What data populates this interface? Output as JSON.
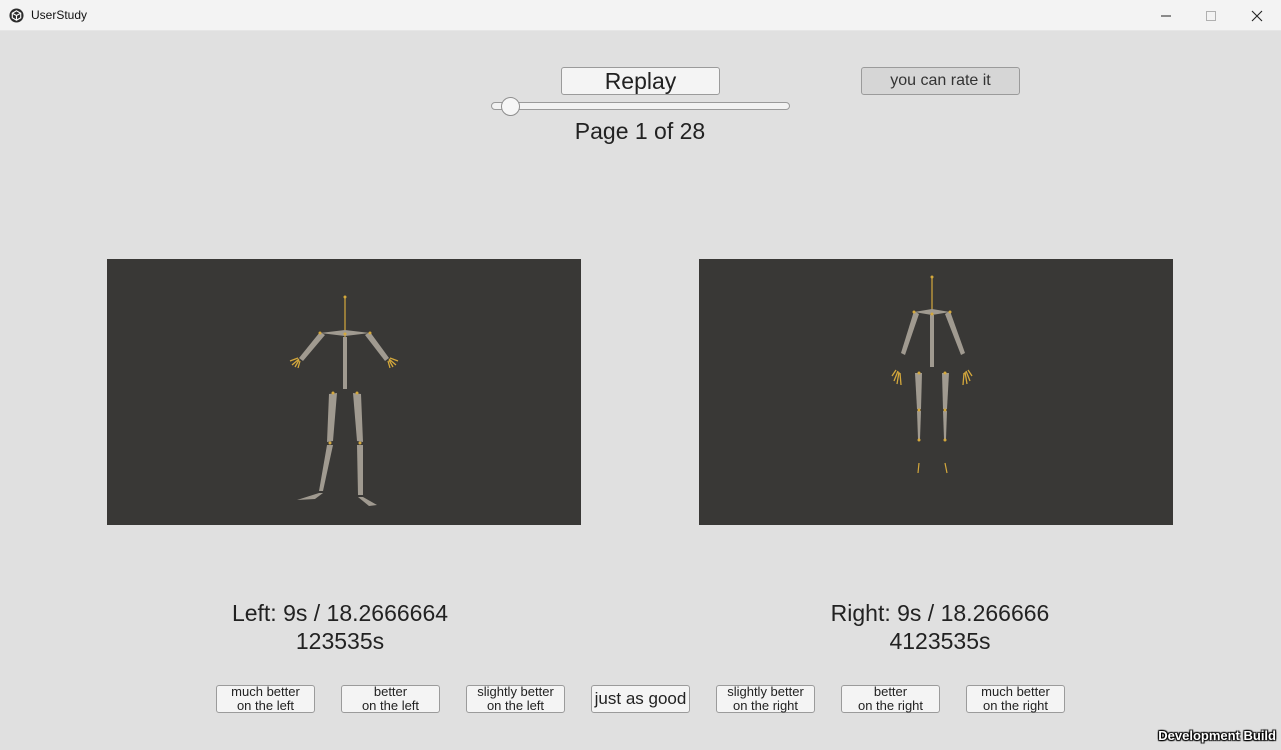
{
  "window": {
    "title": "UserStudy",
    "icon": "unity-logo-icon",
    "controls": [
      "minimize-icon",
      "maximize-icon",
      "close-icon"
    ]
  },
  "toolbar": {
    "replay_label": "Replay",
    "rate_label": "you can rate it",
    "page_label": "Page 1 of 28",
    "slider": {
      "page": 1,
      "page_count": 28
    }
  },
  "viewports": {
    "left": {
      "background": "#393836",
      "content": "skeleton-figure"
    },
    "right": {
      "background": "#393836",
      "content": "skeleton-figure"
    }
  },
  "times": {
    "left": "Left: 9s / 18.2666664123535s",
    "right": "Right: 9s / 18.2666664123535s"
  },
  "ratings": [
    {
      "line1": "much better",
      "line2": "on the left"
    },
    {
      "line1": "better",
      "line2": "on the left"
    },
    {
      "line1": "slightly better",
      "line2": "on the left"
    },
    {
      "line1": "just as good",
      "line2": ""
    },
    {
      "line1": "slightly better",
      "line2": "on the right"
    },
    {
      "line1": "better",
      "line2": "on the right"
    },
    {
      "line1": "much better",
      "line2": "on the right"
    }
  ],
  "footer": {
    "dev_build": "Development Build"
  },
  "colors": {
    "background": "#e0e0e0",
    "viewport": "#393836",
    "bone": "#a09a90",
    "joint": "#d4a83c"
  }
}
